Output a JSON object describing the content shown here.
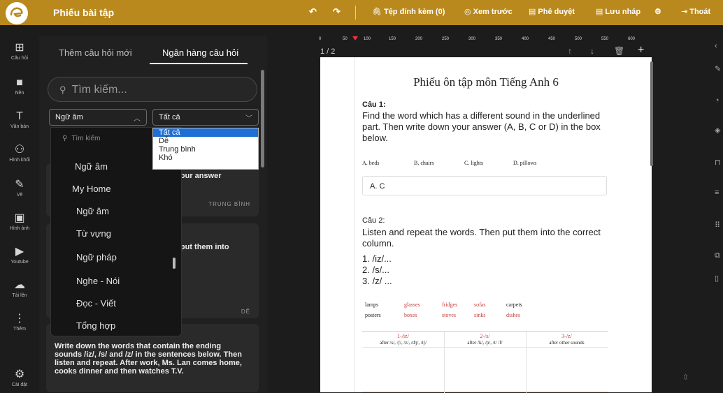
{
  "header": {
    "app_title": "Phiếu bài tập",
    "toolbar": {
      "attach": "Tệp đính kèm (0)",
      "preview": "Xem trước",
      "approve": "Phê duyệt",
      "draft": "Lưu nháp",
      "exit": "Thoát"
    }
  },
  "left_rail": [
    {
      "label": "Câu hỏi",
      "icon": "question-list-icon",
      "glyph": "⊞"
    },
    {
      "label": "Nền",
      "icon": "background-icon",
      "glyph": "■"
    },
    {
      "label": "Văn bản",
      "icon": "text-icon",
      "glyph": "T"
    },
    {
      "label": "Hình khối",
      "icon": "shapes-icon",
      "glyph": "⚇"
    },
    {
      "label": "Vẽ",
      "icon": "draw-icon",
      "glyph": "✎"
    },
    {
      "label": "Hình ảnh",
      "icon": "image-icon",
      "glyph": "▣"
    },
    {
      "label": "Youtube",
      "icon": "youtube-icon",
      "glyph": "▶"
    },
    {
      "label": "Tải lên",
      "icon": "upload-icon",
      "glyph": "☁"
    },
    {
      "label": "Thêm",
      "icon": "more-icon",
      "glyph": "⋮"
    },
    {
      "label": "Cài đặt",
      "icon": "settings-icon",
      "glyph": "⚙"
    }
  ],
  "panel": {
    "tabs": [
      "Thêm câu hỏi mới",
      "Ngân hàng câu hỏi"
    ],
    "active_tab": "Ngân hàng câu hỏi",
    "search_placeholder": "Tìm kiếm...",
    "topic_select": {
      "value": "Ngữ âm"
    },
    "level_select": {
      "value": "Tất cả",
      "options": [
        "Tất cả",
        "Dễ",
        "Trung bình",
        "Khó"
      ]
    },
    "topic_dropdown": {
      "search_placeholder": "Tìm kiếm",
      "items": [
        "Ngữ âm",
        "My Home",
        "Ngữ âm",
        "Từ vựng",
        "Ngữ pháp",
        "Nghe - Nói",
        "Đọc - Viết",
        "Tổng hợp"
      ]
    },
    "cards": [
      {
        "text": "n your answer",
        "level": "TRUNG BÌNH"
      },
      {
        "text": "en put them into",
        "level": "DỄ"
      },
      {
        "text": "Write down the words that contain the ending sounds /iz/, /s/ and /z/ in the sentences below. Then listen and repeat. After work, Ms. Lan comes home, cooks dinner and then watches T.V."
      }
    ]
  },
  "ruler": {
    "ticks": [
      "0",
      "50",
      "100",
      "150",
      "200",
      "250",
      "300",
      "350",
      "400",
      "450",
      "500",
      "550",
      "600"
    ]
  },
  "page_counter": "1 / 2",
  "document": {
    "title": "Phiếu ôn tập môn Tiếng Anh 6",
    "q1": {
      "label": "Câu 1:",
      "text": "Find the word which has a different sound in the underlined part. Then write down your answer (A, B, C or D) in the box below.",
      "options": [
        "A. beds",
        "B. chairs",
        "C. lights",
        "D. pillows"
      ],
      "answer": "A. C"
    },
    "q2": {
      "label": "Câu 2:",
      "text": "Listen and repeat the words. Then put them into the correct column.",
      "items": [
        "1. /iz/...",
        "2. /s/...",
        "3. /z/ ..."
      ],
      "words": [
        "lamps",
        "glasses",
        "fridges",
        "sofas",
        "carpets",
        "posters",
        "boxes",
        "stoves",
        "sinks",
        "dishes"
      ],
      "table_headers": [
        "1-/iz/",
        "2-/s/",
        "3-/z/"
      ],
      "table_subs": [
        "after /s/, /ʃ/, /z/, /dʒ/, /tʃ/",
        "after /k/, /p/, /t/ /f/",
        "after other sounds"
      ]
    }
  },
  "colors": {
    "topbar": "#b9891e",
    "selected": "#1f6fd4",
    "accent_red": "#c23b3b"
  }
}
